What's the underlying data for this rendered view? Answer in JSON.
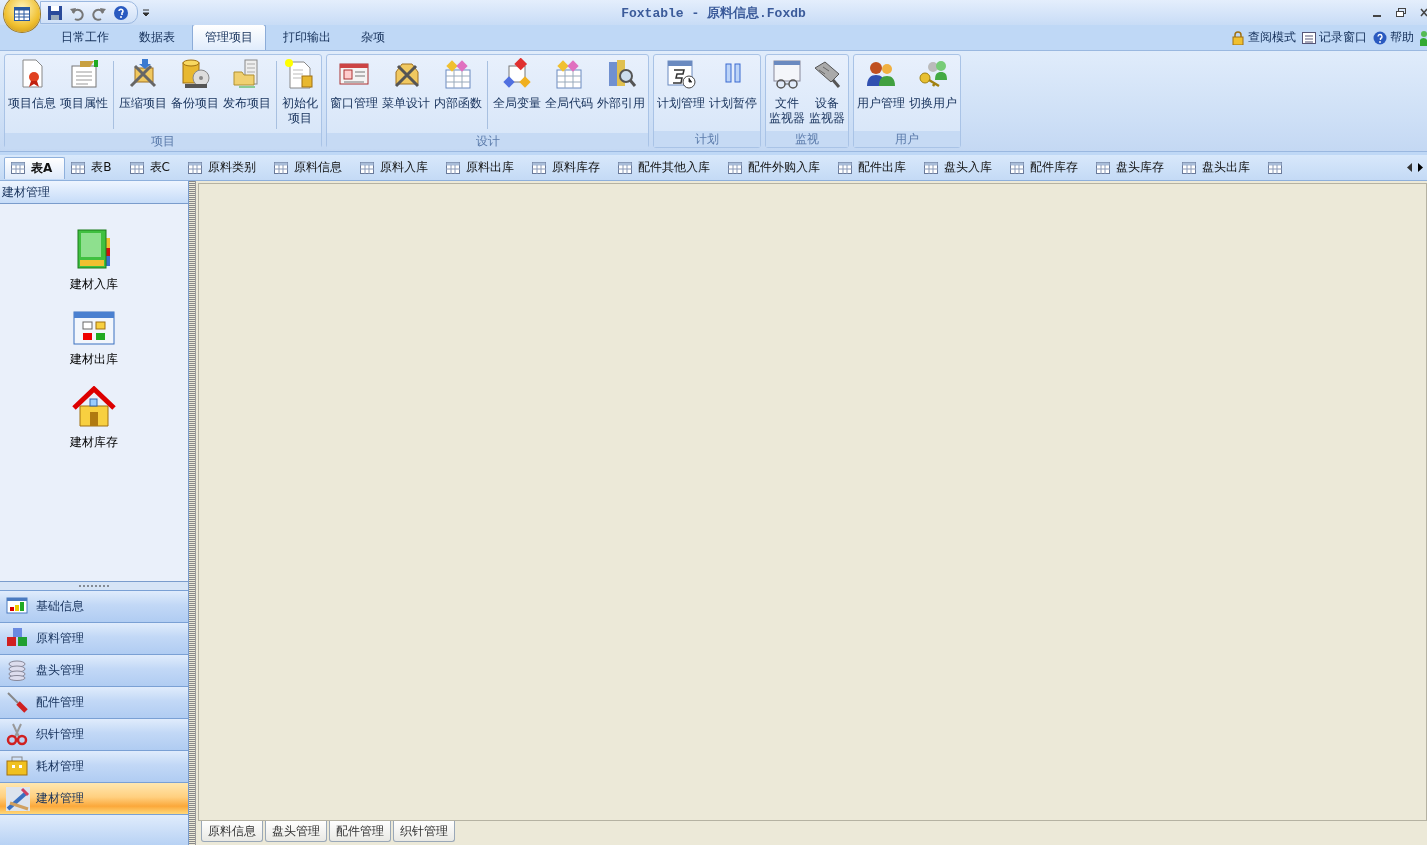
{
  "title_bar": {
    "title": "Foxtable - 原料信息.Foxdb"
  },
  "ribbon_tabs": [
    {
      "label": "日常工作",
      "selected": false
    },
    {
      "label": "数据表",
      "selected": false
    },
    {
      "label": "管理项目",
      "selected": true
    },
    {
      "label": "打印输出",
      "selected": false
    },
    {
      "label": "杂项",
      "selected": false
    }
  ],
  "ribbon_links": [
    "查阅模式",
    "记录窗口",
    "帮助"
  ],
  "ribbon_groups": [
    {
      "title": "项目",
      "sets": [
        [
          {
            "lines": [
              "项目信息"
            ]
          },
          {
            "lines": [
              "项目属性"
            ]
          }
        ],
        [
          {
            "lines": [
              "压缩项目"
            ]
          },
          {
            "lines": [
              "备份项目"
            ]
          },
          {
            "lines": [
              "发布项目"
            ]
          }
        ],
        [
          {
            "lines": [
              "初始化",
              "项目"
            ]
          }
        ]
      ]
    },
    {
      "title": "设计",
      "sets": [
        [
          {
            "lines": [
              "窗口管理"
            ]
          },
          {
            "lines": [
              "菜单设计"
            ]
          },
          {
            "lines": [
              "内部函数"
            ]
          }
        ],
        [
          {
            "lines": [
              "全局变量"
            ]
          },
          {
            "lines": [
              "全局代码"
            ]
          },
          {
            "lines": [
              "外部引用"
            ]
          }
        ]
      ]
    },
    {
      "title": "计划",
      "sets": [
        [
          {
            "lines": [
              "计划管理"
            ]
          },
          {
            "lines": [
              "计划暂停"
            ]
          }
        ]
      ]
    },
    {
      "title": "监视",
      "sets": [
        [
          {
            "lines": [
              "文件",
              "监视器"
            ]
          },
          {
            "lines": [
              "设备",
              "监视器"
            ]
          }
        ]
      ]
    },
    {
      "title": "用户",
      "sets": [
        [
          {
            "lines": [
              "用户管理"
            ]
          },
          {
            "lines": [
              "切换用户"
            ]
          }
        ]
      ]
    }
  ],
  "table_tabs": [
    {
      "label": "表A",
      "selected": true
    },
    {
      "label": "表B",
      "selected": false
    },
    {
      "label": "表C",
      "selected": false
    },
    {
      "label": "原料类别",
      "selected": false
    },
    {
      "label": "原料信息",
      "selected": false
    },
    {
      "label": "原料入库",
      "selected": false
    },
    {
      "label": "原料出库",
      "selected": false
    },
    {
      "label": "原料库存",
      "selected": false
    },
    {
      "label": "配件其他入库",
      "selected": false
    },
    {
      "label": "配件外购入库",
      "selected": false
    },
    {
      "label": "配件出库",
      "selected": false
    },
    {
      "label": "盘头入库",
      "selected": false
    },
    {
      "label": "配件库存",
      "selected": false
    },
    {
      "label": "盘头库存",
      "selected": false
    },
    {
      "label": "盘头出库",
      "selected": false
    }
  ],
  "sidebar": {
    "header": "建材管理",
    "items": [
      "建材入库",
      "建材出库",
      "建材库存"
    ],
    "nav": [
      {
        "label": "基础信息",
        "selected": false
      },
      {
        "label": "原料管理",
        "selected": false
      },
      {
        "label": "盘头管理",
        "selected": false
      },
      {
        "label": "配件管理",
        "selected": false
      },
      {
        "label": "织针管理",
        "selected": false
      },
      {
        "label": "耗材管理",
        "selected": false
      },
      {
        "label": "建材管理",
        "selected": true
      }
    ]
  },
  "bottom_tabs": [
    "原料信息",
    "盘头管理",
    "配件管理",
    "织针管理"
  ]
}
